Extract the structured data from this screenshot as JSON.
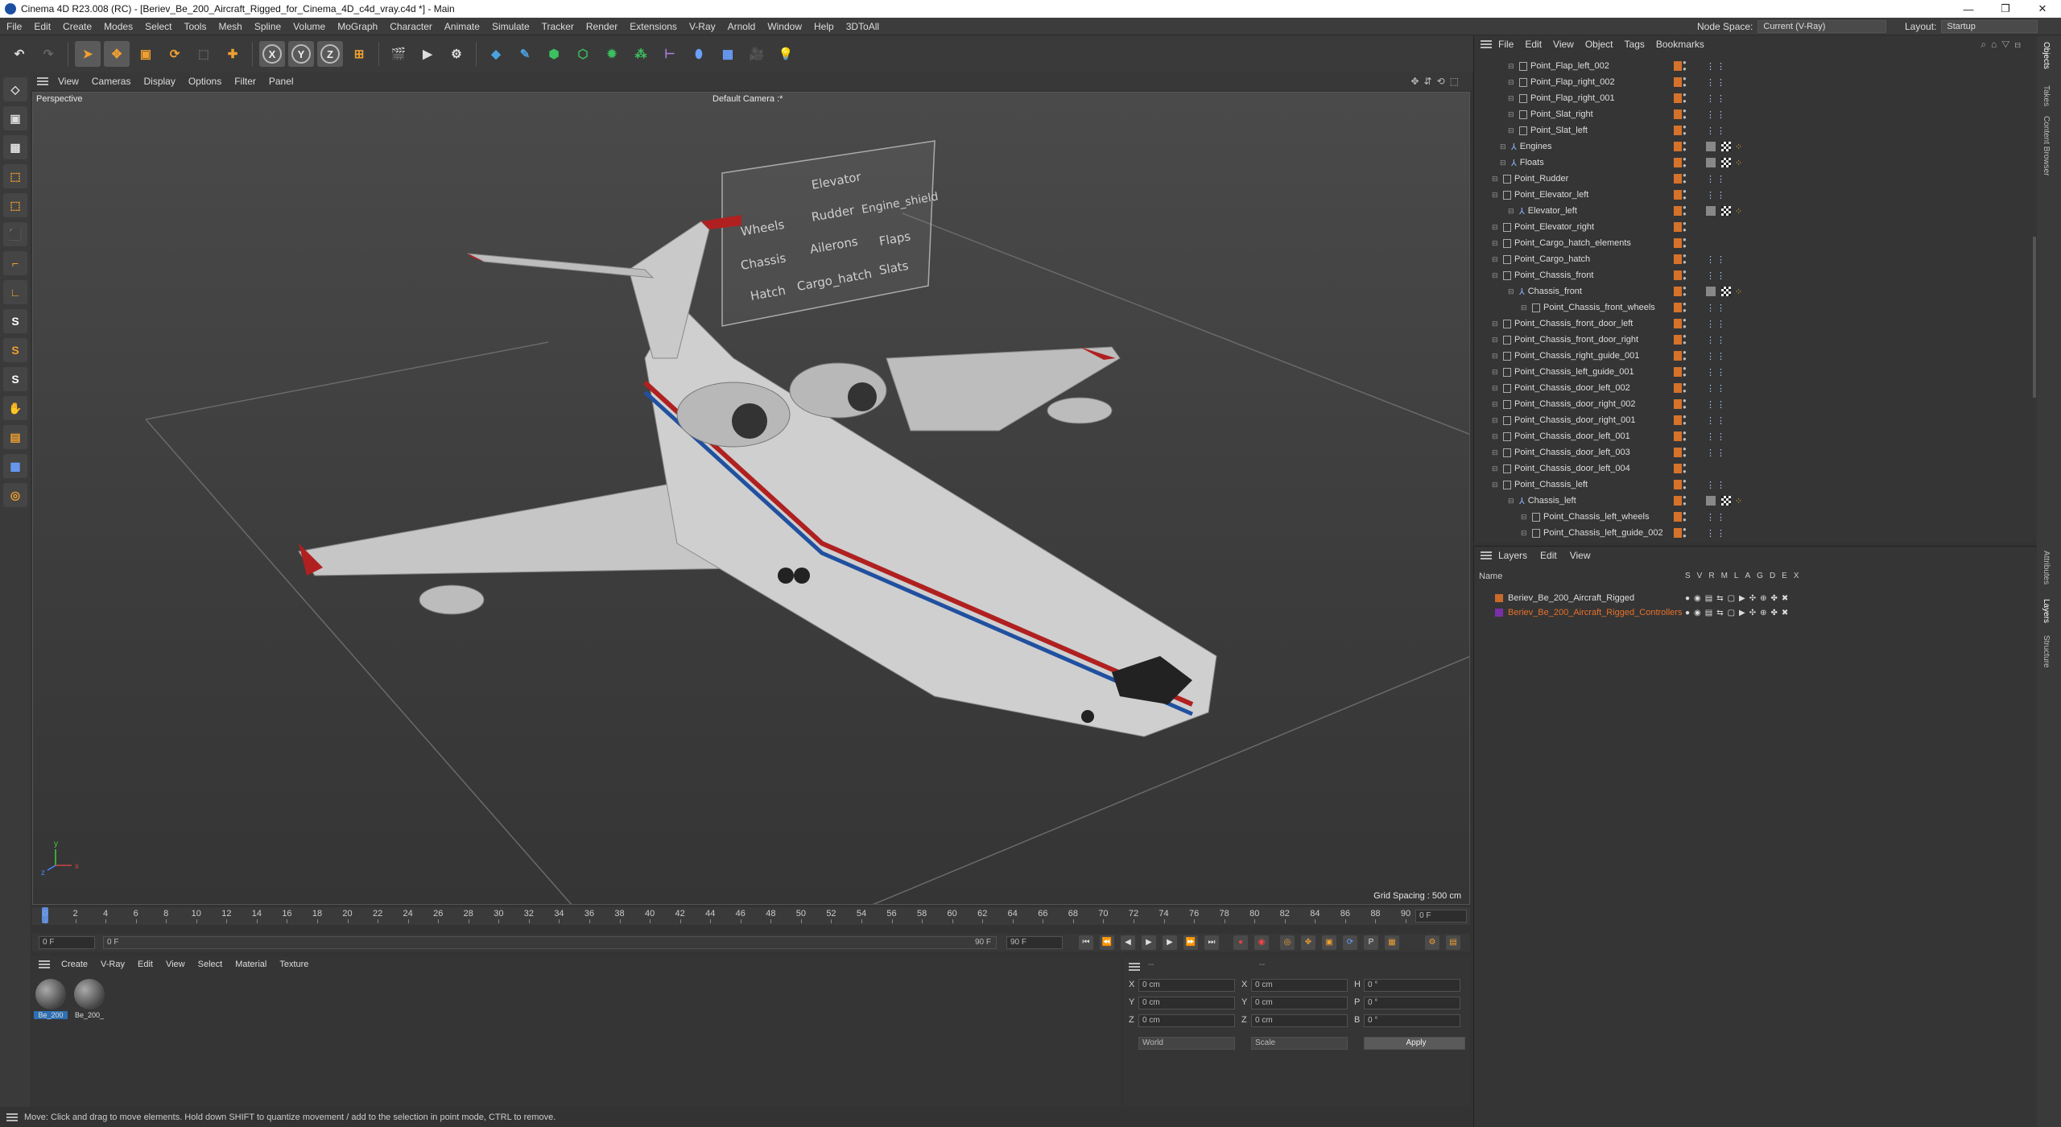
{
  "window": {
    "title": "Cinema 4D R23.008 (RC) - [Beriev_Be_200_Aircraft_Rigged_for_Cinema_4D_c4d_vray.c4d *] - Main",
    "controls": [
      "—",
      "❐",
      "✕"
    ]
  },
  "menubar": {
    "items": [
      "File",
      "Edit",
      "Create",
      "Modes",
      "Select",
      "Tools",
      "Mesh",
      "Spline",
      "Volume",
      "MoGraph",
      "Character",
      "Animate",
      "Simulate",
      "Tracker",
      "Render",
      "Extensions",
      "V-Ray",
      "Arnold",
      "Window",
      "Help",
      "3DToAll"
    ],
    "node_space_label": "Node Space:",
    "node_space_value": "Current (V-Ray)",
    "layout_label": "Layout:",
    "layout_value": "Startup"
  },
  "toolbar": {
    "axis_x": "X",
    "axis_y": "Y",
    "axis_z": "Z"
  },
  "lefttools": {
    "items": [
      "S",
      "S",
      "S"
    ]
  },
  "viewport": {
    "menu": [
      "View",
      "Cameras",
      "Display",
      "Options",
      "Filter",
      "Panel"
    ],
    "view_name": "Perspective",
    "camera_name": "Default Camera :*",
    "grid_spacing": "Grid Spacing : 500 cm",
    "panel_labels": [
      "Elevator",
      "Wheels",
      "Rudder",
      "Engine_shield",
      "Flaps",
      "Chassis",
      "Ailerons",
      "Slats",
      "Hatch",
      "Cargo_hatch"
    ],
    "axis_labels": [
      "y",
      "x",
      "z"
    ]
  },
  "timeline": {
    "ticks": [
      "0",
      "2",
      "4",
      "6",
      "8",
      "10",
      "12",
      "14",
      "16",
      "18",
      "20",
      "22",
      "24",
      "26",
      "28",
      "30",
      "32",
      "34",
      "36",
      "38",
      "40",
      "42",
      "44",
      "46",
      "48",
      "50",
      "52",
      "54",
      "56",
      "58",
      "60",
      "62",
      "64",
      "66",
      "68",
      "70",
      "72",
      "74",
      "76",
      "78",
      "80",
      "82",
      "84",
      "86",
      "88",
      "90"
    ],
    "current_frame": "0 F",
    "start_frame": "0 F",
    "min_frame": "0 F",
    "end_frame": "90 F",
    "max_frame": "90 F"
  },
  "materials": {
    "menu": [
      "Create",
      "V-Ray",
      "Edit",
      "View",
      "Select",
      "Material",
      "Texture"
    ],
    "items": [
      "Be_200",
      "Be_200_"
    ]
  },
  "coordinates": {
    "header": "--",
    "header2": "--",
    "rows": [
      {
        "a": "X",
        "av": "0 cm",
        "b": "X",
        "bv": "0 cm",
        "c": "H",
        "cv": "0 °"
      },
      {
        "a": "Y",
        "av": "0 cm",
        "b": "Y",
        "bv": "0 cm",
        "c": "P",
        "cv": "0 °"
      },
      {
        "a": "Z",
        "av": "0 cm",
        "b": "Z",
        "bv": "0 cm",
        "c": "B",
        "cv": "0 °"
      }
    ],
    "world": "World",
    "scale": "Scale",
    "apply": "Apply"
  },
  "status": {
    "text": "Move: Click and drag to move elements. Hold down SHIFT to quantize movement / add to the selection in point mode, CTRL to remove."
  },
  "object_manager": {
    "menu": [
      "File",
      "Edit",
      "View",
      "Object",
      "Tags",
      "Bookmarks"
    ],
    "rows": [
      {
        "name": "Point_Flap_left_002",
        "type": "null"
      },
      {
        "name": "Point_Flap_right_002",
        "type": "null"
      },
      {
        "name": "Point_Flap_right_001",
        "type": "null"
      },
      {
        "name": "Point_Slat_right",
        "type": "null"
      },
      {
        "name": "Point_Slat_left",
        "type": "null"
      },
      {
        "name": "Engines",
        "type": "bone"
      },
      {
        "name": "Floats",
        "type": "bone"
      },
      {
        "name": "Point_Rudder",
        "type": "null"
      },
      {
        "name": "Point_Elevator_left",
        "type": "null"
      },
      {
        "name": "Elevator_left",
        "type": "bone"
      },
      {
        "name": "Point_Elevator_right",
        "type": "null"
      },
      {
        "name": "Point_Cargo_hatch_elements",
        "type": "null"
      },
      {
        "name": "Point_Cargo_hatch",
        "type": "null"
      },
      {
        "name": "Point_Chassis_front",
        "type": "null"
      },
      {
        "name": "Chassis_front",
        "type": "bone"
      },
      {
        "name": "Point_Chassis_front_wheels",
        "type": "null"
      },
      {
        "name": "Point_Chassis_front_door_left",
        "type": "null"
      },
      {
        "name": "Point_Chassis_front_door_right",
        "type": "null"
      },
      {
        "name": "Point_Chassis_right_guide_001",
        "type": "null"
      },
      {
        "name": "Point_Chassis_left_guide_001",
        "type": "null"
      },
      {
        "name": "Point_Chassis_door_left_002",
        "type": "null"
      },
      {
        "name": "Point_Chassis_door_right_002",
        "type": "null"
      },
      {
        "name": "Point_Chassis_door_right_001",
        "type": "null"
      },
      {
        "name": "Point_Chassis_door_left_001",
        "type": "null"
      },
      {
        "name": "Point_Chassis_door_left_003",
        "type": "null"
      },
      {
        "name": "Point_Chassis_door_left_004",
        "type": "null"
      },
      {
        "name": "Point_Chassis_left",
        "type": "null"
      },
      {
        "name": "Chassis_left",
        "type": "bone"
      },
      {
        "name": "Point_Chassis_left_wheels",
        "type": "null"
      },
      {
        "name": "Point_Chassis_left_guide_002",
        "type": "null"
      }
    ]
  },
  "layer_manager": {
    "menu": [
      "Layers",
      "Edit",
      "View"
    ],
    "col_name": "Name",
    "col_flags": [
      "S",
      "V",
      "R",
      "M",
      "L",
      "A",
      "G",
      "D",
      "E",
      "X"
    ],
    "rows": [
      {
        "name": "Beriev_Be_200_Aircraft_Rigged",
        "color": "#c86a2a"
      },
      {
        "name": "Beriev_Be_200_Aircraft_Rigged_Controllers",
        "color": "#7a2fa8"
      }
    ]
  },
  "rightbar": {
    "tabs_top": [
      "Objects",
      "Takes",
      "Content Browser"
    ],
    "tabs_bottom": [
      "Attributes",
      "Layers",
      "Structure"
    ]
  },
  "colors": {
    "accent_orange": "#d6722a",
    "controller_purple": "#7a2fa8",
    "selected_blue": "#2f6fb3"
  }
}
